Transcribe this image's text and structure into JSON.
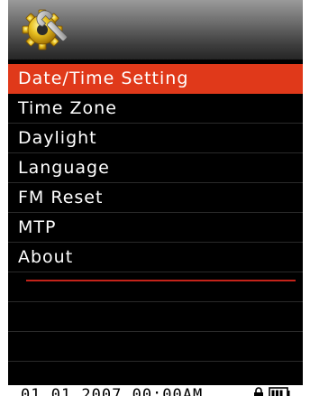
{
  "header": {
    "icon": "gear-wrench-settings-icon"
  },
  "menu": {
    "items": [
      {
        "label": "Date/Time Setting",
        "selected": true
      },
      {
        "label": "Time Zone",
        "selected": false
      },
      {
        "label": "Daylight",
        "selected": false
      },
      {
        "label": "Language",
        "selected": false
      },
      {
        "label": "FM Reset",
        "selected": false
      },
      {
        "label": "MTP",
        "selected": false
      },
      {
        "label": "About",
        "selected": false
      }
    ]
  },
  "status": {
    "datetime": "01.01.2007 00:00AM",
    "lock_icon": "lock-icon",
    "battery_icon": "battery-icon"
  },
  "colors": {
    "selected_bg": "#e0391a",
    "divider": "#c4231a",
    "background": "#000000",
    "text": "#ffffff"
  }
}
